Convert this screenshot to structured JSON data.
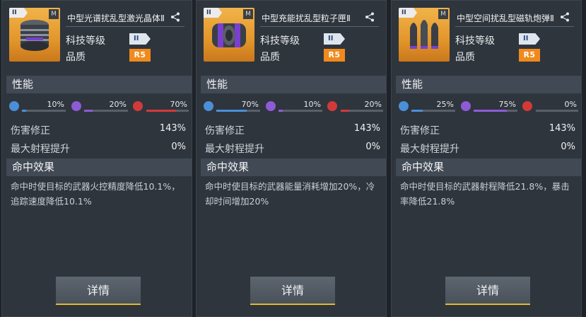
{
  "ui": {
    "tech_level_label": "科技等级",
    "quality_label": "品质",
    "performance_label": "性能",
    "hit_effect_label": "命中效果",
    "damage_mod_label": "伤害修正",
    "range_bonus_label": "最大射程提升",
    "detail_button": "详情",
    "tier_numeral": "II",
    "module_badge": "M"
  },
  "stat_colors": {
    "energy": "#4a8fd8",
    "psionic": "#8d5bd6",
    "heat": "#d23a3a"
  },
  "cards": [
    {
      "name": "中型光谱扰乱型激光晶体Ⅱ",
      "quality": "R5",
      "stats": [
        {
          "icon": "lightning-icon",
          "pct_label": "10%",
          "pct": 10
        },
        {
          "icon": "psionic-icon",
          "pct_label": "20%",
          "pct": 20
        },
        {
          "icon": "flame-icon",
          "pct_label": "70%",
          "pct": 70
        }
      ],
      "damage_mod": "143%",
      "range_bonus": "0%",
      "effect": "命中时使目标的武器火控精度降低10.1%，追踪速度降低10.1%",
      "image": "laser-crystal-icon"
    },
    {
      "name": "中型充能扰乱型粒子匣Ⅱ",
      "quality": "R5",
      "stats": [
        {
          "icon": "lightning-icon",
          "pct_label": "70%",
          "pct": 70
        },
        {
          "icon": "psionic-icon",
          "pct_label": "10%",
          "pct": 10
        },
        {
          "icon": "flame-icon",
          "pct_label": "20%",
          "pct": 20
        }
      ],
      "damage_mod": "143%",
      "range_bonus": "0%",
      "effect": "命中时使目标的武器能量消耗增加20%，冷却时间增加20%",
      "image": "particle-cartridge-icon"
    },
    {
      "name": "中型空间扰乱型磁轨炮弹Ⅱ",
      "quality": "R5",
      "stats": [
        {
          "icon": "lightning-icon",
          "pct_label": "25%",
          "pct": 25
        },
        {
          "icon": "psionic-icon",
          "pct_label": "75%",
          "pct": 75
        },
        {
          "icon": "flame-icon",
          "pct_label": "0%",
          "pct": 0
        }
      ],
      "damage_mod": "143%",
      "range_bonus": "0%",
      "effect": "命中时使目标的武器射程降低21.8%，暴击率降低21.8%",
      "image": "railgun-shell-icon"
    }
  ]
}
